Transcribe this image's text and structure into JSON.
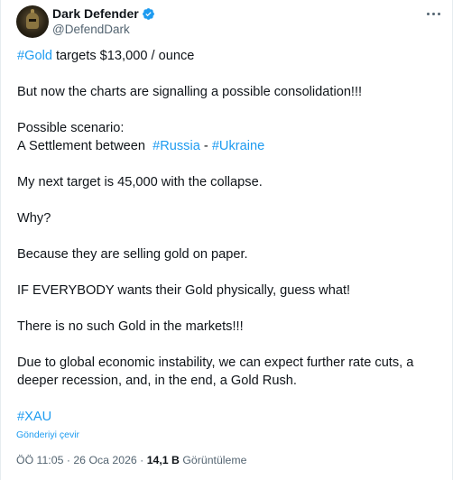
{
  "author": {
    "display_name": "Dark Defender",
    "handle": "@DefendDark",
    "verified_color": "#1d9bf0"
  },
  "menu": {
    "icon": "more-horizontal-icon"
  },
  "tweet": {
    "line1": {
      "hashtag": "#Gold",
      "text": " targets $13,000 / ounce"
    },
    "line2": "But now the charts are signalling a possible consolidation!!!",
    "line3": "Possible scenario:",
    "line4": {
      "text": "A Settlement between  ",
      "hashtag1": "#Russia",
      "sep": " - ",
      "hashtag2": "#Ukraine"
    },
    "line5": "My next target is 45,000 with the collapse.",
    "line6": "Why?",
    "line7": "Because they are selling gold on paper.",
    "line8": "IF EVERYBODY wants their Gold physically, guess what!",
    "line9": "There is no such Gold in the markets!!!",
    "line10": "Due to global economic instability, we can expect further rate cuts, a",
    "line11": "deeper recession, and, in the end, a Gold Rush.",
    "line12": "#XAU"
  },
  "translate_label": "Gönderiyi çevir",
  "meta": {
    "time": "ÖÖ 11:05",
    "sep": " · ",
    "date": "26 Oca 2026",
    "views_count": "14,1 B",
    "views_label": " Görüntüleme"
  }
}
